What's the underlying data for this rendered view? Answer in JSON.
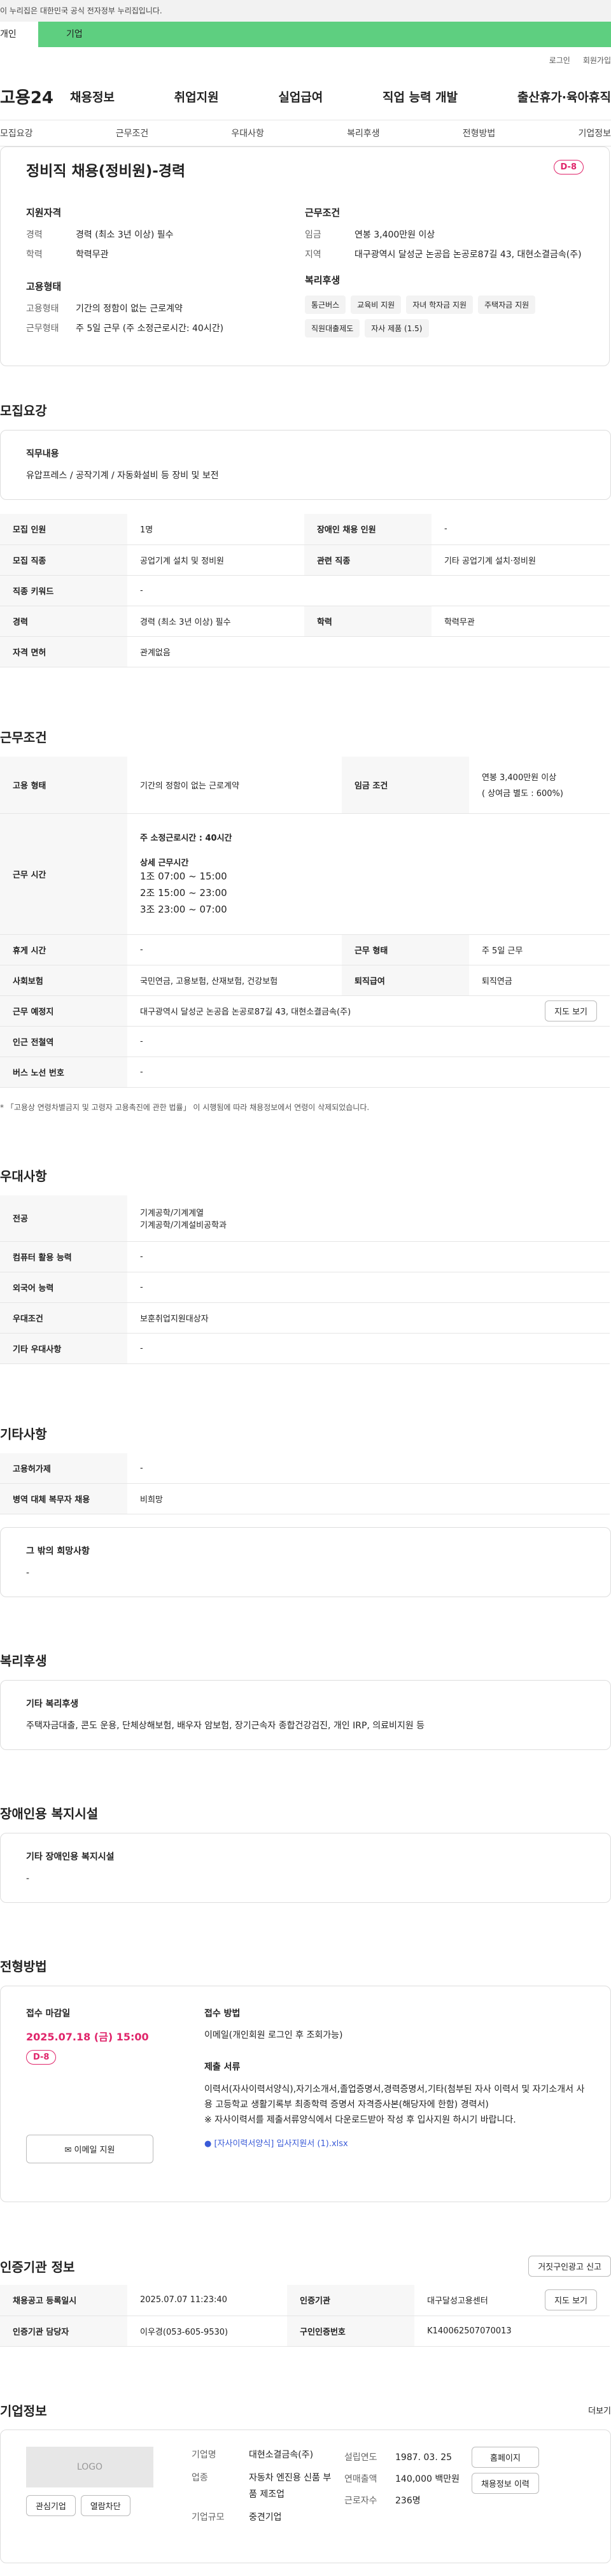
{
  "gov_banner": "이 누리집은 대한민국 공식 전자정부 누리집입니다.",
  "user_tabs": {
    "personal": "개인",
    "company": "기업"
  },
  "util": {
    "login": "로그인",
    "join": "회원가입"
  },
  "logo": "고용24",
  "gnb": [
    "채용정보",
    "취업지원",
    "실업급여",
    "직업 능력 개발",
    "출산휴가·육아휴직"
  ],
  "tabs": [
    "모집요강",
    "근무조건",
    "우대사항",
    "복리후생",
    "전형방법",
    "기업정보"
  ],
  "summary": {
    "title": "정비직 채용(정비원)-경력",
    "dday": "D-8",
    "qual_head": "지원자격",
    "qual": [
      {
        "k": "경력",
        "v": "경력 (최소 3년 이상) 필수"
      },
      {
        "k": "학력",
        "v": "학력무관"
      }
    ],
    "emp_head": "고용형태",
    "emp": [
      {
        "k": "고용형태",
        "v": "기간의 정함이 없는 근로계약"
      },
      {
        "k": "근무형태",
        "v": "주 5일 근무 (주 소정근로시간: 40시간)"
      }
    ],
    "cond_head": "근무조건",
    "cond": [
      {
        "k": "임금",
        "v": "연봉 3,400만원 이상"
      },
      {
        "k": "지역",
        "v": "대구광역시 달성군 논공읍 논공로87길 43, 대현소결금속(주)"
      }
    ],
    "welfare_head": "복리후생",
    "chips": [
      "통근버스",
      "교육비 지원",
      "자녀 학자금 지원",
      "주택자금 지원",
      "직원대출제도",
      "자사 제품 (1.5)"
    ]
  },
  "recruit": {
    "title": "모집요강",
    "job_label": "직무내용",
    "job_text": "유압프레스 / 공작기계 / 자동화설비 등 장비 및 보전",
    "rows": [
      [
        "모집 인원",
        "1명",
        "장애인 채용 인원",
        "-"
      ],
      [
        "모집 직종",
        "공업기계 설치 및 정비원",
        "관련 직종",
        "기타 공업기계 설치·정비원"
      ],
      [
        "직종 키워드",
        "-",
        "",
        ""
      ],
      [
        "경력",
        "경력 (최소 3년 이상) 필수",
        "학력",
        "학력무관"
      ],
      [
        "자격 면허",
        "관계없음",
        "",
        ""
      ]
    ]
  },
  "work": {
    "title": "근무조건",
    "employment_label": "고용 형태",
    "employment": "기간의 정함이 없는 근로계약",
    "wage_label": "임금 조건",
    "wage": "연봉 3,400만원 이상",
    "wage_note": "( 상여금 별도 : 600%)",
    "hours_label": "근무 시간",
    "hours_week": "주 소정근로시간 : 40시간",
    "hours_detail_title": "상세 근무시간",
    "shifts": [
      "1조 07:00 ~ 15:00",
      "2조 15:00 ~ 23:00",
      "3조 23:00 ~ 07:00"
    ],
    "rest_label": "휴게 시간",
    "rest": "-",
    "type_label": "근무 형태",
    "type": "주 5일 근무",
    "ins_label": "사회보험",
    "ins": "국민연금, 고용보험, 산재보험, 건강보험",
    "ret_label": "퇴직급여",
    "ret": "퇴직연금",
    "place_label": "근무 예정지",
    "place": "대구광역시 달성군 논공읍 논공로87길 43, 대현소결금속(주)",
    "map_btn": "지도 보기",
    "station_label": "인근 전철역",
    "station": "-",
    "bus_label": "버스 노선 번호",
    "bus": "-",
    "note": "* 「고용상 연령차별금지 및 고령자 고용촉진에 관한 법률」 이 시행됨에 따라 채용정보에서 연령이 삭제되었습니다."
  },
  "pref": {
    "title": "우대사항",
    "rows": [
      [
        "전공",
        "기계공학/기계계열\n기계공학/기계설비공학과"
      ],
      [
        "컴퓨터 활용 능력",
        "-"
      ],
      [
        "외국어 능력",
        "-"
      ],
      [
        "우대조건",
        "보훈취업지원대상자"
      ],
      [
        "기타 우대사항",
        "-"
      ]
    ]
  },
  "etc": {
    "title": "기타사항",
    "rows": [
      [
        "고용허가제",
        "-"
      ],
      [
        "병역 대체 복무자 채용",
        "비희망"
      ]
    ],
    "other_label": "그 밖의 희망사항",
    "other": "-"
  },
  "welfare": {
    "title": "복리후생",
    "label": "기타 복리후생",
    "text": "주택자금대출, 콘도 운용, 단체상해보험, 배우자 암보험, 장기근속자 종합건강검진, 개인 IRP, 의료비지원 등"
  },
  "disability": {
    "title": "장애인용 복지시설",
    "label": "기타 장애인용 복지시설",
    "text": "-"
  },
  "process": {
    "title": "전형방법",
    "deadline_label": "접수 마감일",
    "deadline": "2025.07.18 (금) 15:00",
    "dday": "D-8",
    "apply_btn": "이메일 지원",
    "method_label": "접수 방법",
    "method": "이메일(개인회원 로그인 후 조회가능)",
    "docs_label": "제출 서류",
    "docs": "이력서(자사이력서양식),자기소개서,졸업증명서,경력증명서,기타(첨부된 자사 이력서 및 자기소개서 사용 고등학교 생활기록부 최종학력 증명서 자격증사본(해당자에 한함) 경력서)",
    "docs2": "※ 자사이력서를 제출서류양식에서 다운로드받아 작성 후 입사지원 하시기 바랍니다.",
    "file": "[자사이력서양식] 입사지원서 (1).xlsx"
  },
  "agency": {
    "title": "인증기관 정보",
    "report_btn": "거짓구인광고 신고",
    "reg_label": "채용공고 등록일시",
    "reg": "2025.07.07 11:23:40",
    "org_label": "인증기관",
    "org": "대구달성고용센터",
    "map_btn": "지도 보기",
    "mgr_label": "인증기관 담당자",
    "mgr": "이우경(053-605-9530)",
    "num_label": "구인인증번호",
    "num": "K140062507070013"
  },
  "company": {
    "title": "기업정보",
    "more": "더보기",
    "logo": "LOGO",
    "fav_btn": "관심기업",
    "block_btn": "열람차단",
    "name_label": "기업명",
    "name": "대현소결금속(주)",
    "ind_label": "업종",
    "ind": "자동차 엔진용 신품 부품 제조업",
    "size_label": "기업규모",
    "size": "중견기업",
    "founded_label": "설립연도",
    "founded": "1987. 03. 25",
    "sales_label": "연매출액",
    "sales": "140,000 백만원",
    "emp_label": "근로자수",
    "emp": "236명",
    "home_btn": "홈페이지",
    "jobs_btn": "채용정보 이력"
  }
}
